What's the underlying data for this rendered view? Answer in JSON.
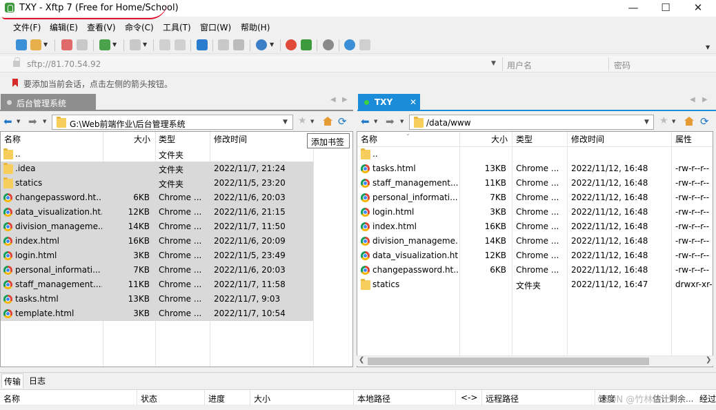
{
  "window": {
    "title": "TXY - Xftp 7 (Free for Home/School)",
    "minimize": "—",
    "maximize": "☐",
    "close": "✕"
  },
  "menu": [
    "文件(F)",
    "编辑(E)",
    "查看(V)",
    "命令(C)",
    "工具(T)",
    "窗口(W)",
    "帮助(H)"
  ],
  "address": {
    "value": "sftp://81.70.54.92",
    "username_placeholder": "用户名",
    "password_placeholder": "密码"
  },
  "hint": "要添加当前会话，点击左侧的箭头按钮。",
  "tooltip": "添加书签",
  "left_pane": {
    "tab_label": "后台管理系统",
    "path": "G:\\Web前端作业\\后台管理系统",
    "columns": [
      "名称",
      "大小",
      "类型",
      "修改时间"
    ],
    "rows": [
      {
        "name": "..",
        "size": "",
        "type": "文件夹",
        "modified": "",
        "icon": "folder-icon",
        "selected": false
      },
      {
        "name": ".idea",
        "size": "",
        "type": "文件夹",
        "modified": "2022/11/7, 21:24",
        "icon": "folder-icon",
        "selected": true
      },
      {
        "name": "statics",
        "size": "",
        "type": "文件夹",
        "modified": "2022/11/5, 23:20",
        "icon": "folder-icon",
        "selected": true
      },
      {
        "name": "changepassword.ht...",
        "size": "6KB",
        "type": "Chrome ...",
        "modified": "2022/11/6, 20:03",
        "icon": "chrome-icon",
        "selected": true
      },
      {
        "name": "data_visualization.ht...",
        "size": "12KB",
        "type": "Chrome ...",
        "modified": "2022/11/6, 21:15",
        "icon": "chrome-icon",
        "selected": true
      },
      {
        "name": "division_manageme...",
        "size": "14KB",
        "type": "Chrome ...",
        "modified": "2022/11/7, 11:50",
        "icon": "chrome-icon",
        "selected": true
      },
      {
        "name": "index.html",
        "size": "16KB",
        "type": "Chrome ...",
        "modified": "2022/11/6, 20:09",
        "icon": "chrome-icon",
        "selected": true
      },
      {
        "name": "login.html",
        "size": "3KB",
        "type": "Chrome ...",
        "modified": "2022/11/5, 23:49",
        "icon": "chrome-icon",
        "selected": true
      },
      {
        "name": "personal_informati...",
        "size": "7KB",
        "type": "Chrome ...",
        "modified": "2022/11/6, 20:03",
        "icon": "chrome-icon",
        "selected": true
      },
      {
        "name": "staff_management....",
        "size": "11KB",
        "type": "Chrome ...",
        "modified": "2022/11/7, 11:58",
        "icon": "chrome-icon",
        "selected": true
      },
      {
        "name": "tasks.html",
        "size": "13KB",
        "type": "Chrome ...",
        "modified": "2022/11/7, 9:03",
        "icon": "chrome-icon",
        "selected": true
      },
      {
        "name": "template.html",
        "size": "3KB",
        "type": "Chrome ...",
        "modified": "2022/11/7, 10:54",
        "icon": "chrome-icon",
        "selected": true
      }
    ]
  },
  "right_pane": {
    "tab_label": "TXY",
    "path": "/data/www",
    "columns": [
      "名称",
      "大小",
      "类型",
      "修改时间",
      "属性"
    ],
    "rows": [
      {
        "name": "..",
        "size": "",
        "type": "",
        "modified": "",
        "attr": "",
        "icon": "folder-icon"
      },
      {
        "name": "tasks.html",
        "size": "13KB",
        "type": "Chrome ...",
        "modified": "2022/11/12, 16:48",
        "attr": "-rw-r--r--",
        "icon": "chrome-icon"
      },
      {
        "name": "staff_management....",
        "size": "11KB",
        "type": "Chrome ...",
        "modified": "2022/11/12, 16:48",
        "attr": "-rw-r--r--",
        "icon": "chrome-icon"
      },
      {
        "name": "personal_informati...",
        "size": "7KB",
        "type": "Chrome ...",
        "modified": "2022/11/12, 16:48",
        "attr": "-rw-r--r--",
        "icon": "chrome-icon"
      },
      {
        "name": "login.html",
        "size": "3KB",
        "type": "Chrome ...",
        "modified": "2022/11/12, 16:48",
        "attr": "-rw-r--r--",
        "icon": "chrome-icon"
      },
      {
        "name": "index.html",
        "size": "16KB",
        "type": "Chrome ...",
        "modified": "2022/11/12, 16:48",
        "attr": "-rw-r--r--",
        "icon": "chrome-icon"
      },
      {
        "name": "division_manageme...",
        "size": "14KB",
        "type": "Chrome ...",
        "modified": "2022/11/12, 16:48",
        "attr": "-rw-r--r--",
        "icon": "chrome-icon"
      },
      {
        "name": "data_visualization.ht...",
        "size": "12KB",
        "type": "Chrome ...",
        "modified": "2022/11/12, 16:48",
        "attr": "-rw-r--r--",
        "icon": "chrome-icon"
      },
      {
        "name": "changepassword.ht...",
        "size": "6KB",
        "type": "Chrome ...",
        "modified": "2022/11/12, 16:48",
        "attr": "-rw-r--r--",
        "icon": "chrome-icon"
      },
      {
        "name": "statics",
        "size": "",
        "type": "文件夹",
        "modified": "2022/11/12, 16:47",
        "attr": "drwxr-xr-x",
        "icon": "folder-icon"
      }
    ]
  },
  "bottom": {
    "tabs": [
      "传输",
      "日志"
    ],
    "columns": [
      "名称",
      "状态",
      "进度",
      "大小",
      "本地路径",
      "<->",
      "远程路径",
      "速度",
      "估计剩余...",
      "经过"
    ]
  },
  "watermark": "CSDN @竹林侠士"
}
